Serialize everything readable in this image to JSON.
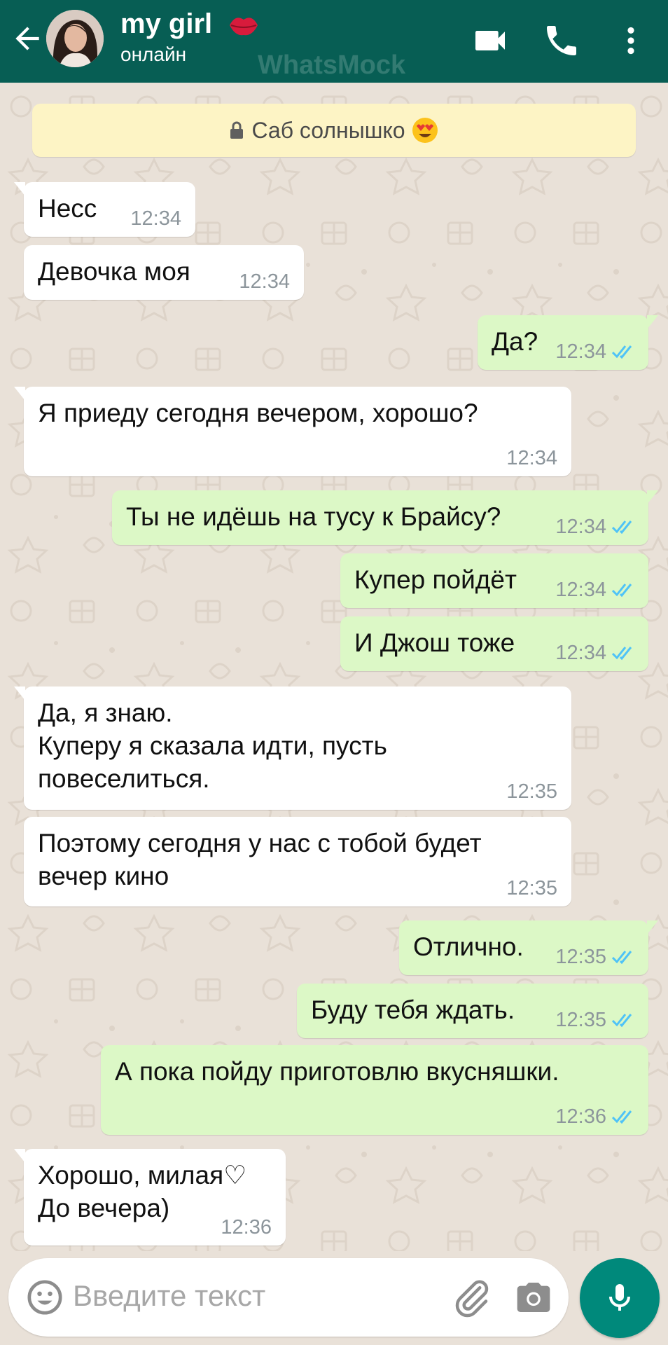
{
  "header": {
    "contact_name": "my girl",
    "status": "онлайн",
    "watermark": "WhatsMock",
    "icons": [
      "back-arrow-icon",
      "lips-emoji-icon",
      "video-call-icon",
      "phone-icon",
      "more-vert-icon"
    ]
  },
  "colors": {
    "header_bg": "#075e54",
    "chat_bg": "#e9e1d8",
    "incoming_bubble": "#ffffff",
    "outgoing_bubble": "#dcf8c6",
    "system_banner": "#fdf4c5",
    "read_ticks": "#4fc3f7",
    "mic_button": "#00897b"
  },
  "system_banner": {
    "text": "Саб солнышко"
  },
  "messages": [
    {
      "direction": "in",
      "text": "Несс",
      "time": "12:34"
    },
    {
      "direction": "in",
      "text": "Девочка моя",
      "time": "12:34"
    },
    {
      "direction": "out",
      "text": "Да?",
      "time": "12:34",
      "status": "read"
    },
    {
      "direction": "in",
      "text": "Я приеду сегодня вечером, хорошо?",
      "time": "12:34"
    },
    {
      "direction": "out",
      "text": "Ты не идёшь на тусу к Брайсу?",
      "time": "12:34",
      "status": "read"
    },
    {
      "direction": "out",
      "text": "Купер пойдёт",
      "time": "12:34",
      "status": "read"
    },
    {
      "direction": "out",
      "text": "И Джош тоже",
      "time": "12:34",
      "status": "read"
    },
    {
      "direction": "in",
      "text": "Да, я знаю.\nКуперу я сказала идти, пусть\nповеселиться.",
      "time": "12:35"
    },
    {
      "direction": "in",
      "text": "Поэтому сегодня у нас с тобой будет\nвечер кино",
      "time": "12:35"
    },
    {
      "direction": "out",
      "text": "Отлично.",
      "time": "12:35",
      "status": "read"
    },
    {
      "direction": "out",
      "text": "Буду тебя ждать.",
      "time": "12:35",
      "status": "read"
    },
    {
      "direction": "out",
      "text": "А пока пойду приготовлю вкусняшки.",
      "time": "12:36",
      "status": "read"
    },
    {
      "direction": "in",
      "text": "Хорошо, милая♡\nДо вечера)",
      "time": "12:36"
    }
  ],
  "composer": {
    "placeholder": "Введите текст",
    "icons": [
      "emoji-icon",
      "paperclip-icon",
      "camera-icon",
      "microphone-icon"
    ]
  }
}
